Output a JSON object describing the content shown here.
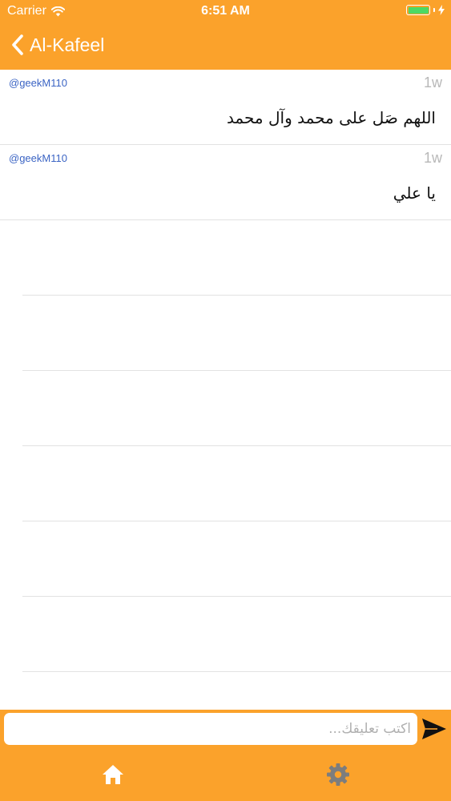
{
  "status_bar": {
    "carrier": "Carrier",
    "time": "6:51 AM",
    "battery_level": 1.0,
    "battery_color": "#4cd964"
  },
  "nav_bar": {
    "back_icon": "chevron-left-icon",
    "title": "Al-Kafeel",
    "background_color": "#fba22b"
  },
  "comments": [
    {
      "user": "@geekM110",
      "time": "1w",
      "text": "اللهم صَل على محمد وآل محمد"
    },
    {
      "user": "@geekM110",
      "time": "1w",
      "text": "يا علي"
    }
  ],
  "composer": {
    "placeholder": "اكتب تعليقك...",
    "value": "",
    "send_icon": "send-icon"
  },
  "tab_bar": {
    "tabs": [
      {
        "icon": "home-icon"
      },
      {
        "icon": "gear-icon"
      }
    ]
  }
}
